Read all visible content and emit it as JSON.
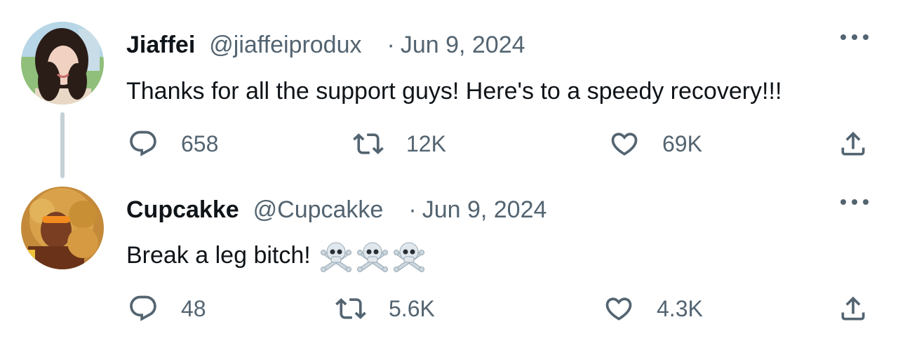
{
  "tweets": [
    {
      "name": "Jiaffei",
      "handle": "@jiaffeiprodux",
      "separator": "·",
      "date": "Jun 9, 2024",
      "text": "Thanks for all the support guys! Here's to a speedy recovery!!!",
      "replies": "658",
      "retweets": "12K",
      "likes": "69K"
    },
    {
      "name": "Cupcakke",
      "handle": "@Cupcakke",
      "separator": "·",
      "date": "Jun 9, 2024",
      "text": "Break a leg bitch!",
      "emoji": [
        "skull-and-crossbones",
        "skull-and-crossbones",
        "skull-and-crossbones"
      ],
      "replies": "48",
      "retweets": "5.6K",
      "likes": "4.3K"
    }
  ],
  "colors": {
    "text": "#0f1419",
    "secondary": "#536471",
    "thread_line": "#c5d0d7"
  },
  "icons": [
    "reply-icon",
    "retweet-icon",
    "like-icon",
    "share-icon",
    "more-icon"
  ]
}
